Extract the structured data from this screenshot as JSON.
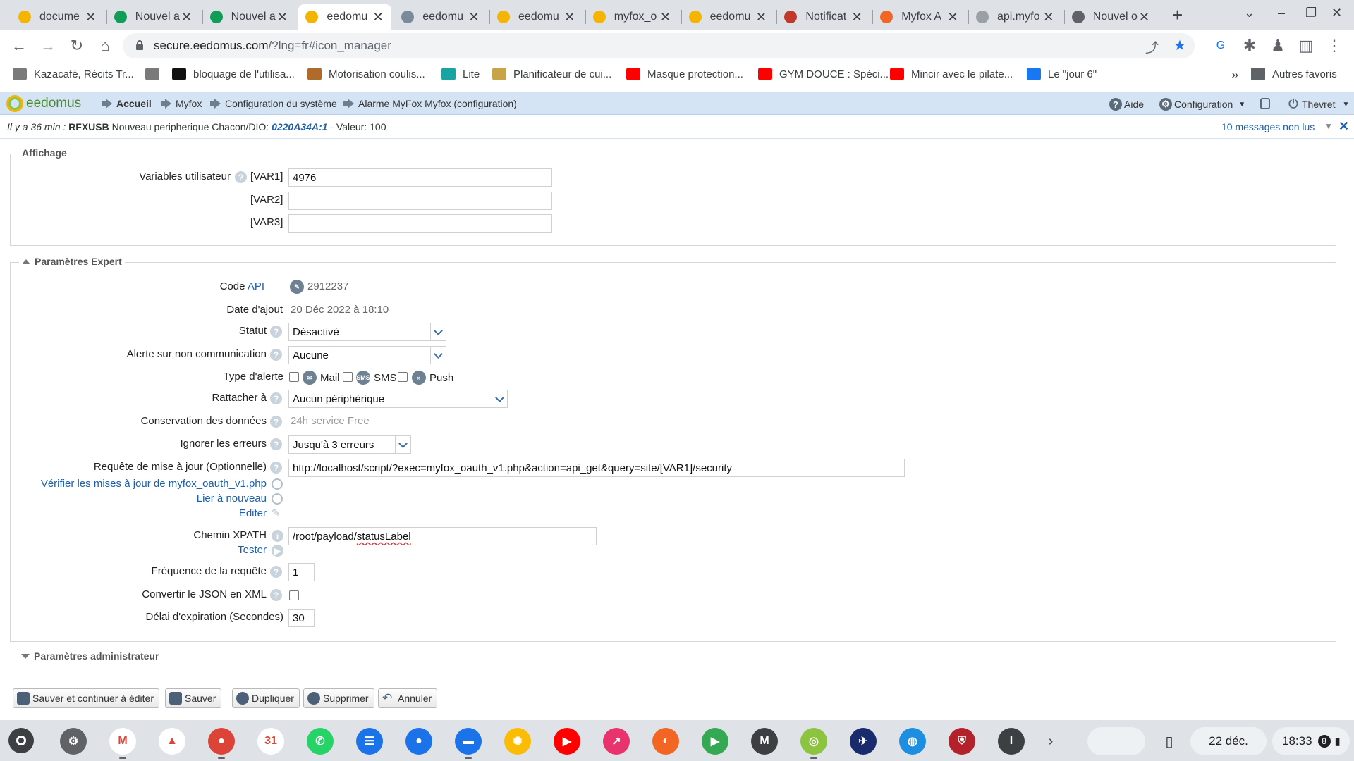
{
  "browser": {
    "tabs": [
      {
        "title": "docume",
        "icon": "google-drive-icon",
        "color": "#f4b400"
      },
      {
        "title": "Nouvel a",
        "icon": "google-sheets-icon",
        "color": "#0f9d58"
      },
      {
        "title": "Nouvel a",
        "icon": "google-sheets-icon",
        "color": "#0f9d58"
      },
      {
        "title": "eedomu",
        "icon": "eedomus-icon",
        "color": "#f5b400"
      },
      {
        "title": "eedomu",
        "icon": "eedomus-icon",
        "color": "#7b8a99"
      },
      {
        "title": "eedomu",
        "icon": "eedomus-icon",
        "color": "#f5b400"
      },
      {
        "title": "myfox_o",
        "icon": "eedomus-icon",
        "color": "#f5b400"
      },
      {
        "title": "eedomu",
        "icon": "eedomus-icon",
        "color": "#f5b400"
      },
      {
        "title": "Notificat",
        "icon": "notification-icon",
        "color": "#c0392b"
      },
      {
        "title": "Myfox A",
        "icon": "myfox-icon",
        "color": "#f26522"
      },
      {
        "title": "api.myfo",
        "icon": "globe-icon",
        "color": "#9aa0a6"
      },
      {
        "title": "Nouvel o",
        "icon": "chrome-icon",
        "color": "#5f6368"
      }
    ],
    "url_host": "secure.eedomus.com",
    "url_rest": "/?lng=fr#icon_manager",
    "bookmarks": [
      {
        "label": "Kazacafé, Récits Tr...",
        "icon": "image-icon",
        "color": "#7a7a7a"
      },
      {
        "label": "",
        "icon": "image-icon",
        "color": "#7a7a7a"
      },
      {
        "label": "bloquage de l'utilisa...",
        "icon": "plus-icon",
        "color": "#111111"
      },
      {
        "label": "Motorisation coulis...",
        "icon": "person-icon",
        "color": "#b06a2b"
      },
      {
        "label": "Lite",
        "icon": "lite-icon",
        "color": "#1aa3a3"
      },
      {
        "label": "Planificateur de cui...",
        "icon": "ka-icon",
        "color": "#c9a34a"
      },
      {
        "label": "Masque protection...",
        "icon": "youtube-icon",
        "color": "#ff0000"
      },
      {
        "label": "GYM DOUCE : Spéci...",
        "icon": "youtube-icon",
        "color": "#ff0000"
      },
      {
        "label": "Mincir avec le pilate...",
        "icon": "youtube-icon",
        "color": "#ff0000"
      },
      {
        "label": "Le \"jour 6\"",
        "icon": "facebook-icon",
        "color": "#1877f2"
      }
    ],
    "bookmarks_more": "»",
    "other_bookmarks": "Autres favoris"
  },
  "app": {
    "logo_text": "eedomus",
    "breadcrumb": [
      "Accueil",
      "Myfox",
      "Configuration du système",
      "Alarme MyFox Myfox (configuration)"
    ],
    "help_label": "Aide",
    "config_label": "Configuration",
    "user_label": "Thevret"
  },
  "notification": {
    "time": "Il y a 36 min :",
    "source": "RFXUSB",
    "text": "Nouveau peripherique Chacon/DIO:",
    "device": "0220A34A:1",
    "value_text": "- Valeur: 100",
    "unread": "10 messages non lus"
  },
  "affichage": {
    "legend": "Affichage",
    "variables_label": "Variables utilisateur",
    "var1_label": "[VAR1]",
    "var1_value": "4976",
    "var2_label": "[VAR2]",
    "var2_value": "",
    "var3_label": "[VAR3]",
    "var3_value": ""
  },
  "expert": {
    "legend": "Paramètres Expert",
    "code_label": "Code",
    "code_link": "API",
    "code_value": "2912237",
    "date_label": "Date d'ajout",
    "date_value": "20 Déc 2022 à 18:10",
    "statut_label": "Statut",
    "statut_value": "Désactivé",
    "alerte_label": "Alerte sur non communication",
    "alerte_value": "Aucune",
    "type_alerte_label": "Type d'alerte",
    "mail_label": "Mail",
    "sms_label": "SMS",
    "push_label": "Push",
    "rattacher_label": "Rattacher à",
    "rattacher_value": "Aucun périphérique",
    "conservation_label": "Conservation des données",
    "conservation_value": "24h service Free",
    "ignorer_label": "Ignorer les erreurs",
    "ignorer_value": "Jusqu'à 3 erreurs",
    "requete_label": "Requête de mise à jour (Optionnelle)",
    "requete_value": "http://localhost/script/?exec=myfox_oauth_v1.php&action=api_get&query=site/[VAR1]/security",
    "verifier_link": "Vérifier les mises à jour de myfox_oauth_v1.php",
    "lier_link": "Lier à nouveau",
    "editer_link": "Editer",
    "xpath_label": "Chemin XPATH",
    "xpath_prefix": "/root/payload/",
    "xpath_suffix": "statusLabel",
    "tester_link": "Tester",
    "frequence_label": "Fréquence de la requête",
    "frequence_value": "1",
    "json_label": "Convertir le JSON en XML",
    "delai_label": "Délai d'expiration (Secondes)",
    "delai_value": "30"
  },
  "admin": {
    "legend": "Paramètres administrateur"
  },
  "actions": {
    "save_continue": "Sauver et continuer à éditer",
    "save": "Sauver",
    "duplicate": "Dupliquer",
    "delete": "Supprimer",
    "cancel": "Annuler"
  },
  "shelf": {
    "apps": [
      {
        "name": "settings-icon",
        "color": "#5f6368",
        "glyph": "⚙"
      },
      {
        "name": "gmail-icon",
        "color": "#ffffff",
        "glyph": "M"
      },
      {
        "name": "google-drive-icon",
        "color": "#ffffff",
        "glyph": "▲"
      },
      {
        "name": "chrome-icon",
        "color": "#db4437",
        "glyph": "●"
      },
      {
        "name": "google-calendar-icon",
        "color": "#ffffff",
        "glyph": "31"
      },
      {
        "name": "whatsapp-icon",
        "color": "#25d366",
        "glyph": "✆"
      },
      {
        "name": "messages-icon",
        "color": "#1a73e8",
        "glyph": "☰"
      },
      {
        "name": "contacts-icon",
        "color": "#1a73e8",
        "glyph": "●"
      },
      {
        "name": "files-icon",
        "color": "#1a73e8",
        "glyph": "▬"
      },
      {
        "name": "google-photos-icon",
        "color": "#fbbc05",
        "glyph": "✺"
      },
      {
        "name": "youtube-icon",
        "color": "#ff0000",
        "glyph": "▶"
      },
      {
        "name": "arrow-app-icon",
        "color": "#e8336d",
        "glyph": "↗"
      },
      {
        "name": "myfox-icon",
        "color": "#f26522",
        "glyph": "◐"
      },
      {
        "name": "play-store-icon",
        "color": "#34a853",
        "glyph": "▶"
      },
      {
        "name": "m-app-icon",
        "color": "#3c4043",
        "glyph": "M"
      },
      {
        "name": "eedomus-app-icon",
        "color": "#8cc43f",
        "glyph": "◎"
      },
      {
        "name": "plane-app-icon",
        "color": "#1a2b6d",
        "glyph": "✈"
      },
      {
        "name": "bouygues-icon",
        "color": "#1d8fe1",
        "glyph": "◍"
      },
      {
        "name": "crest-app-icon",
        "color": "#b3222a",
        "glyph": "⛨"
      },
      {
        "name": "i-app-icon",
        "color": "#3c4043",
        "glyph": "I"
      }
    ],
    "date": "22 déc.",
    "time": "18:33",
    "badge": "8"
  }
}
